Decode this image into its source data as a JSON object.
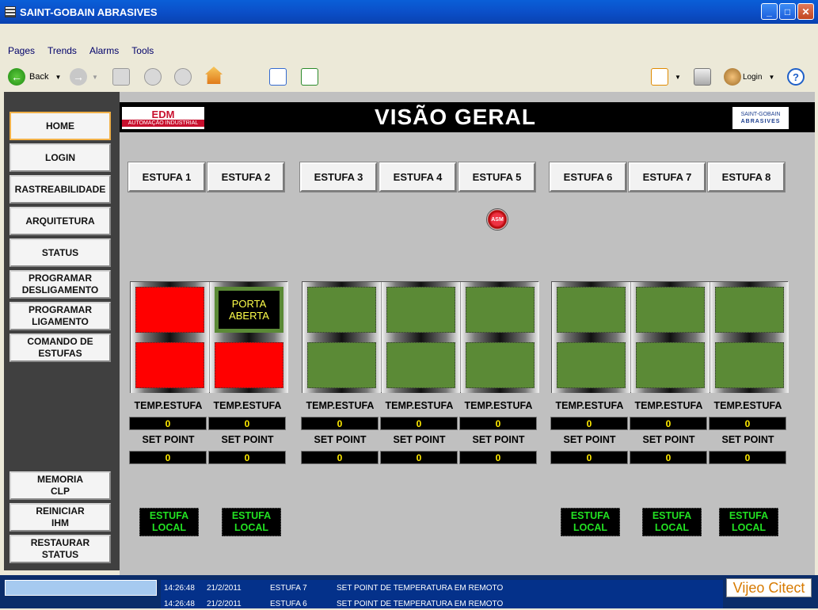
{
  "window": {
    "title": "SAINT-GOBAIN ABRASIVES"
  },
  "menu": [
    "Pages",
    "Trends",
    "Alarms",
    "Tools"
  ],
  "toolbar": {
    "back_label": "Back",
    "login_label": "Login",
    "help_label": "?"
  },
  "nav": {
    "top": [
      "HOME",
      "LOGIN",
      "RASTREABILIDADE",
      "ARQUITETURA",
      "STATUS",
      "PROGRAMAR DESLIGAMENTO",
      "PROGRAMAR LIGAMENTO",
      "COMANDO DE ESTUFAS"
    ],
    "bottom": [
      "MEMORIA CLP",
      "REINICIAR IHM",
      "RESTAURAR STATUS"
    ]
  },
  "header": {
    "title": "VISÃO GERAL",
    "logo_left_big": "EDM",
    "logo_left_small": "AUTOMAÇÃO INDUSTRIAL",
    "logo_right_top": "SAINT-GOBAIN",
    "logo_right_bottom": "ABRASIVES"
  },
  "estufas": [
    "ESTUFA 1",
    "ESTUFA 2",
    "ESTUFA 3",
    "ESTUFA 4",
    "ESTUFA 5",
    "ESTUFA 6",
    "ESTUFA 7",
    "ESTUFA 8"
  ],
  "alarm_icon_text": "ASM",
  "status": {
    "door_open_text": "PORTA ABERTA",
    "top_lamps": [
      "red",
      "open",
      "green",
      "green",
      "green",
      "green",
      "green",
      "green"
    ],
    "bottom_lamps": [
      "red",
      "red",
      "green",
      "green",
      "green",
      "green",
      "green",
      "green"
    ]
  },
  "labels": {
    "temp": "TEMP.ESTUFA",
    "setpoint": "SET POINT"
  },
  "temps": [
    "0",
    "0",
    "0",
    "0",
    "0",
    "0",
    "0",
    "0"
  ],
  "setpoints": [
    "0",
    "0",
    "0",
    "0",
    "0",
    "0",
    "0",
    "0"
  ],
  "local_label": "ESTUFA LOCAL",
  "local_visible": [
    true,
    true,
    false,
    false,
    false,
    true,
    true,
    true
  ],
  "alarms": [
    {
      "time": "14:26:48",
      "date": "21/2/2011",
      "source": "ESTUFA 7",
      "message": "SET POINT DE TEMPERATURA EM REMOTO"
    },
    {
      "time": "14:26:48",
      "date": "21/2/2011",
      "source": "ESTUFA 6",
      "message": "SET POINT DE TEMPERATURA EM REMOTO"
    }
  ],
  "brand": "Vijeo Citect",
  "colors": {
    "lamp_green": "#5b8a36",
    "lamp_red": "#ff0000",
    "value_yellow": "#ffea00",
    "local_green": "#22e122"
  }
}
